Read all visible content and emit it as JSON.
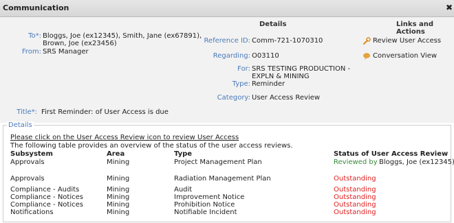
{
  "window": {
    "title": "Communication"
  },
  "header": {
    "to_label": "To*:",
    "to_value_1": "Bloggs, Joe (ex12345), Smith, Jane (ex67891),",
    "to_value_2": "Brown, Joe (ex23456)",
    "from_label": "From:",
    "from_value": "SRS Manager",
    "details_heading": "Details",
    "reference_label": "Reference ID:",
    "reference_value": "Comm-721-1070310",
    "regarding_label": "Regarding:",
    "regarding_value": "O03110",
    "for_label": "For:",
    "for_value_1": "SRS TESTING PRODUCTION -",
    "for_value_2": "EXPLN & MINING",
    "type_label": "Type:",
    "type_value": "Reminder",
    "category_label": "Category:",
    "category_value": "User Access Review",
    "title_label": "Title*:",
    "title_value": "First Reminder:  of User Access is due",
    "links_heading": "Links and Actions",
    "link_review": "Review User Access",
    "link_conversation": "Conversation View"
  },
  "details": {
    "legend": "Details",
    "instruction": "Please click on the User Access Review icon to review User Access",
    "overview": "The following table provides an overview of the status of the user access reviews.",
    "columns": [
      "Subsystem",
      "Area",
      "Type",
      "Status of User Access Review"
    ],
    "rows": [
      {
        "subsystem": "Approvals",
        "area": "Mining",
        "type": "Project Management Plan",
        "status_prefix": "Reviewed by",
        "status": "Bloggs, Joe (ex12345),",
        "status_color": "#3a8a3a"
      },
      {
        "subsystem": "Approvals",
        "area": "Mining",
        "type": "Radiation Management Plan",
        "status_prefix": "",
        "status": "Outstanding",
        "status_color": "#e02020"
      },
      {
        "subsystem": "Compliance - Audits",
        "area": "Mining",
        "type": "Audit",
        "status_prefix": "",
        "status": "Outstanding",
        "status_color": "#e02020"
      },
      {
        "subsystem": "Compliance - Notices",
        "area": "Mining",
        "type": "Improvement Notice",
        "status_prefix": "",
        "status": "Outstanding",
        "status_color": "#e02020"
      },
      {
        "subsystem": "Compliance - Notices",
        "area": "Mining",
        "type": "Prohibition Notice",
        "status_prefix": "",
        "status": "Outstanding",
        "status_color": "#e02020"
      },
      {
        "subsystem": "Notifications",
        "area": "Mining",
        "type": "Notifiable Incident",
        "status_prefix": "",
        "status": "Outstanding",
        "status_color": "#e02020"
      }
    ]
  }
}
